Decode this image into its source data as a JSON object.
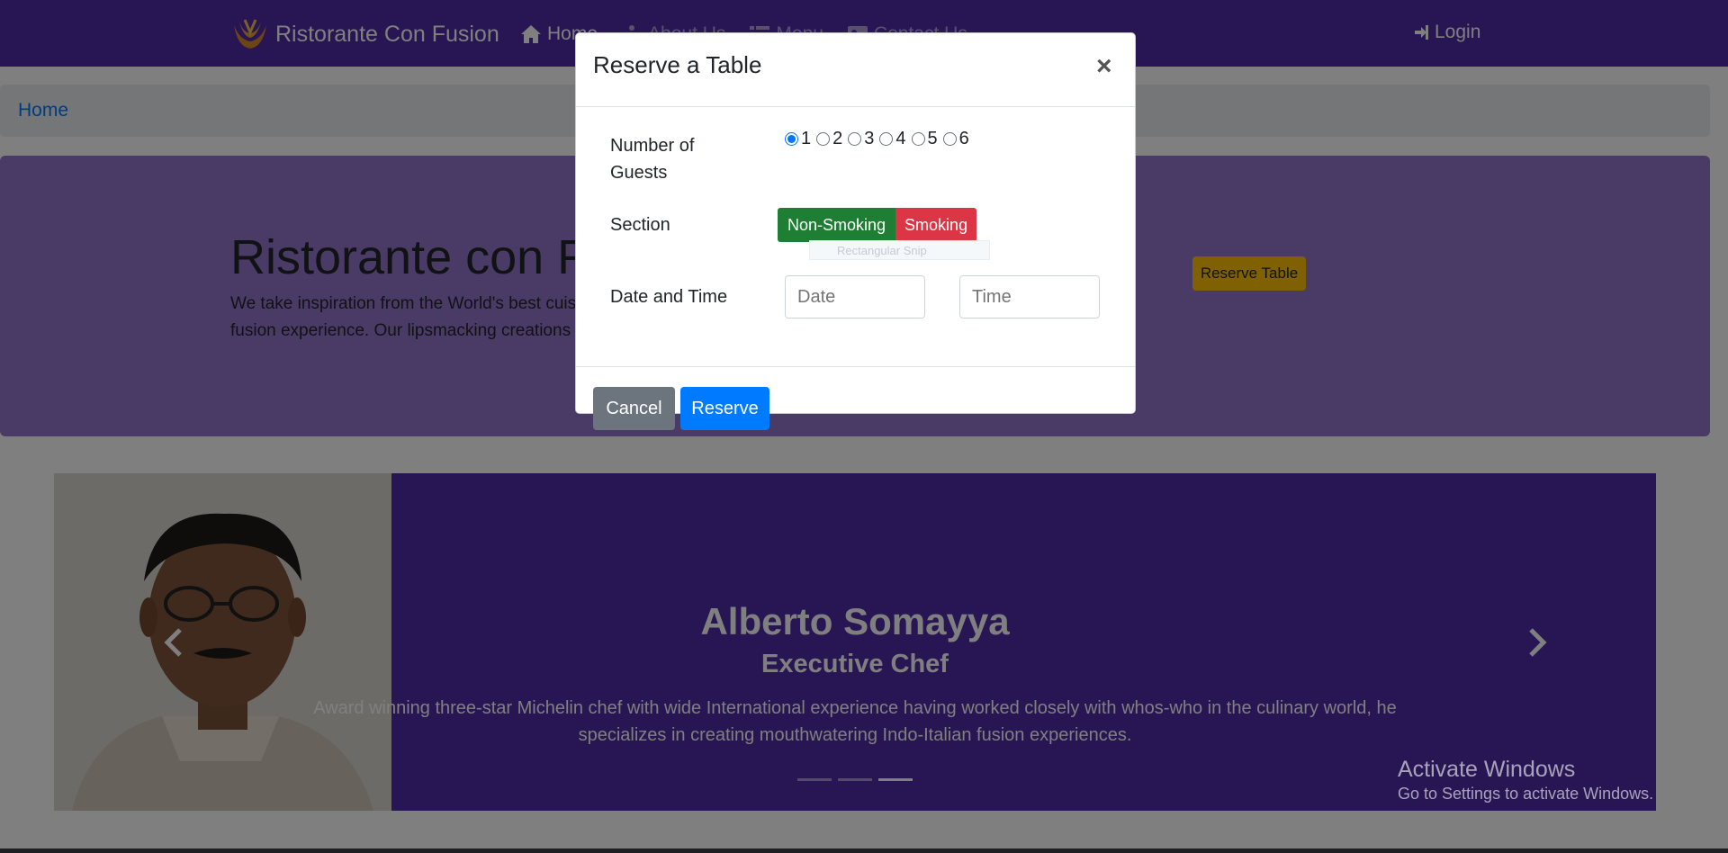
{
  "navbar": {
    "brand": "Ristorante Con Fusion",
    "links": [
      {
        "label": "Home",
        "icon": "home-icon"
      },
      {
        "label": "About Us",
        "icon": "info-icon"
      },
      {
        "label": "Menu",
        "icon": "list-icon"
      },
      {
        "label": "Contact Us",
        "icon": "address-card-icon"
      }
    ],
    "login": {
      "label": "Login",
      "icon": "sign-in-icon"
    },
    "colors": {
      "primary": "#512DA8"
    }
  },
  "breadcrumb": {
    "home": "Home"
  },
  "jumbotron": {
    "title": "Ristorante con Fusion",
    "text_line1": "We take inspiration from the World's best cuisines, and create a unique",
    "text_line2": "fusion experience. Our lipsmacking creations will tickle your culinary senses!",
    "reserve_button": "Reserve Table",
    "colors": {
      "background": "#9575CD",
      "button": "#FFC107"
    }
  },
  "carousel": {
    "name": "Alberto Somayya",
    "title": "Executive Chef",
    "description": "Award winning three-star Michelin chef with wide International experience having worked closely with whos-who in the culinary world, he specializes in creating mouthwatering Indo-Italian fusion experiences.",
    "active_slide": 3,
    "slide_count": 3
  },
  "modal": {
    "title": "Reserve a Table",
    "close": "×",
    "guests_label": "Number of Guests",
    "guest_options": [
      "1",
      "2",
      "3",
      "4",
      "5",
      "6"
    ],
    "selected_guests": "1",
    "section_label": "Section",
    "section_options": {
      "non_smoking": "Non-Smoking",
      "smoking": "Smoking"
    },
    "datetime_label": "Date and Time",
    "date_placeholder": "Date",
    "time_placeholder": "Time",
    "cancel": "Cancel",
    "reserve": "Reserve"
  },
  "snip_tooltip": "Rectangular Snip",
  "activate_windows": {
    "line1": "Activate Windows",
    "line2": "Go to Settings to activate Windows."
  }
}
